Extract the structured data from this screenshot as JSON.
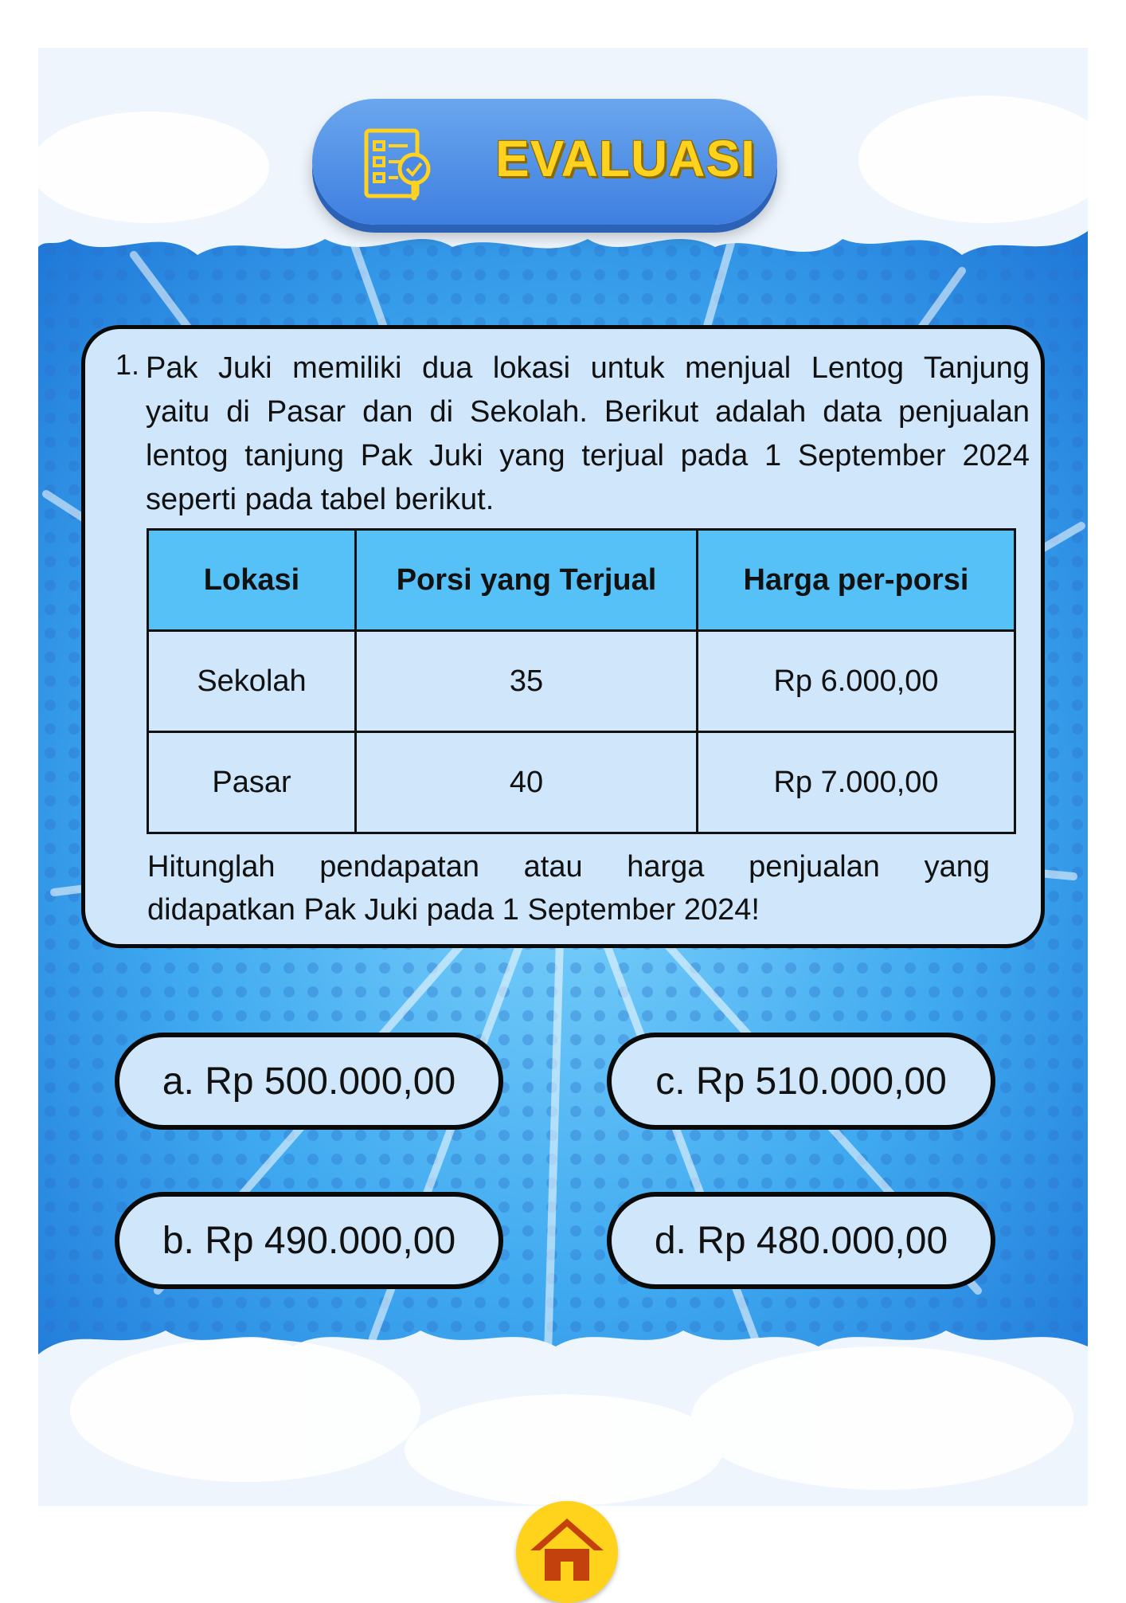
{
  "header": {
    "title": "EVALUASI",
    "icon": "checklist-search-icon"
  },
  "question": {
    "number": "1.",
    "lines": [
      "Pak Juki memiliki dua lokasi untuk menjual Lentog Tanjung",
      "yaitu di Pasar dan di Sekolah. Berikut adalah data penjualan",
      "lentog tanjung Pak Juki yang terjual pada 1 September 2024",
      "seperti pada tabel berikut."
    ],
    "table": {
      "headers": [
        "Lokasi",
        "Porsi yang Terjual",
        "Harga per-porsi"
      ],
      "rows": [
        [
          "Sekolah",
          "35",
          "Rp 6.000,00"
        ],
        [
          "Pasar",
          "40",
          "Rp 7.000,00"
        ]
      ]
    },
    "prompt_lines": [
      "Hitunglah pendapatan atau harga penjualan yang",
      "didapatkan Pak Juki pada 1 September 2024!"
    ]
  },
  "options": {
    "a": "a. Rp 500.000,00",
    "b": "b. Rp 490.000,00",
    "c": "c. Rp 510.000,00",
    "d": "d. Rp 480.000,00"
  },
  "footer": {
    "home_icon": "home-icon"
  },
  "colors": {
    "title_text": "#ffd21f",
    "pill": "#4a8ae6",
    "card_bg": "#cfe6fb",
    "table_header": "#56c1f7",
    "home_button": "#ffd31c",
    "home_icon": "#c2410c"
  }
}
